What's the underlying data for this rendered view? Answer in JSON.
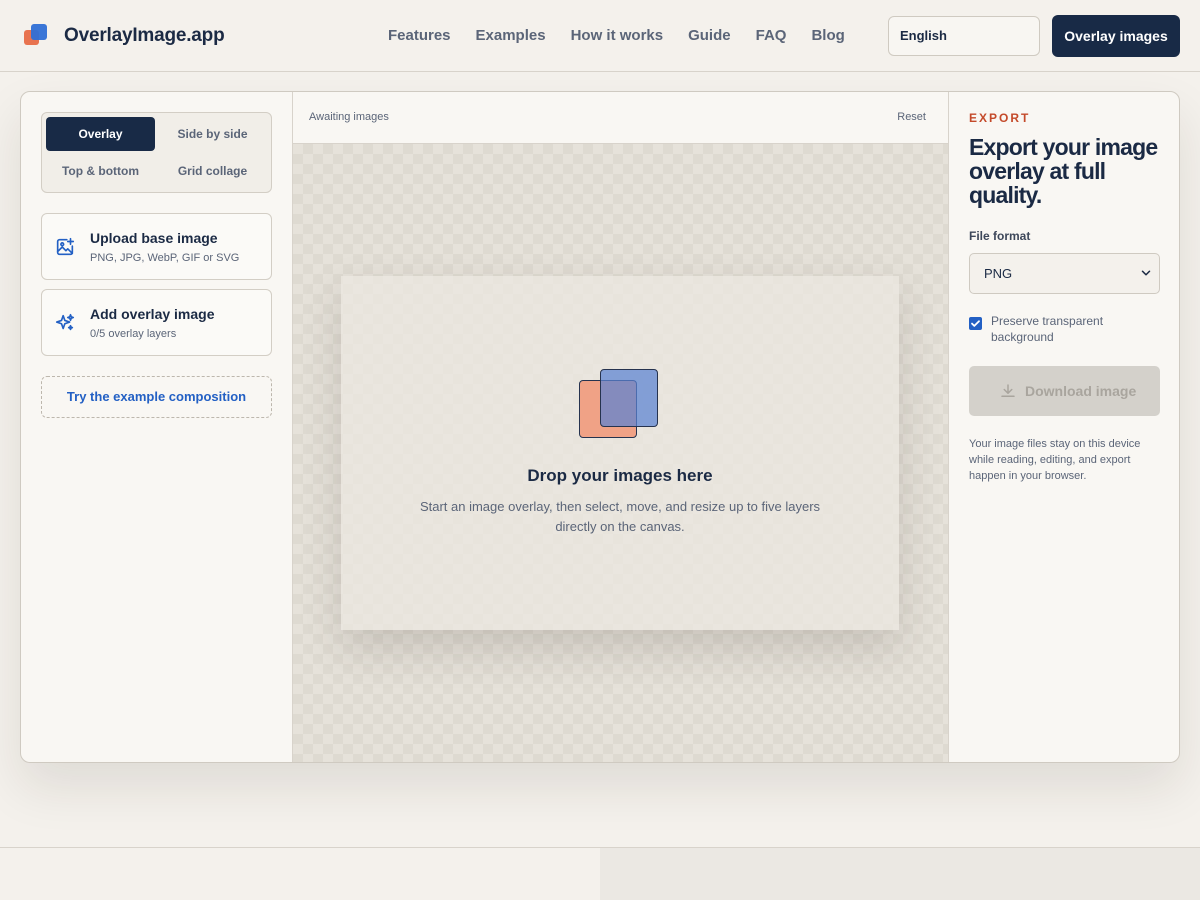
{
  "header": {
    "brand": "OverlayImage.app",
    "nav": [
      "Features",
      "Examples",
      "How it works",
      "Guide",
      "FAQ",
      "Blog"
    ],
    "language": "English",
    "cta": "Overlay images"
  },
  "modes": {
    "items": [
      "Overlay",
      "Side by side",
      "Top & bottom",
      "Grid collage"
    ],
    "selected": "Overlay"
  },
  "uploads": {
    "base": {
      "title": "Upload base image",
      "subtitle": "PNG, JPG, WebP, GIF or SVG"
    },
    "overlay": {
      "title": "Add overlay image",
      "subtitle": "0/5 overlay layers"
    },
    "example": "Try the example composition"
  },
  "canvas": {
    "status": "Awaiting images",
    "reset": "Reset",
    "drop_title": "Drop your images here",
    "drop_subtitle": "Start an image overlay, then select, move, and resize up to five layers directly on the canvas."
  },
  "export": {
    "eyebrow": "EXPORT",
    "headline": "Export your image overlay at full quality.",
    "format_label": "File format",
    "format_value": "PNG",
    "preserve_label": "Preserve transparent background",
    "preserve_checked": true,
    "download": "Download image",
    "privacy": "Your image files stay on this device while reading, editing, and export happen in your browser."
  },
  "colors": {
    "navy": "#182a46",
    "accent_orange": "#c44a2a",
    "link_blue": "#2360c4"
  },
  "icons": {
    "logo": "brand-logo-icon",
    "upload_base": "image-plus-icon",
    "add_overlay": "sparkles-icon",
    "download": "download-icon",
    "select": "chevron-down-icon"
  }
}
